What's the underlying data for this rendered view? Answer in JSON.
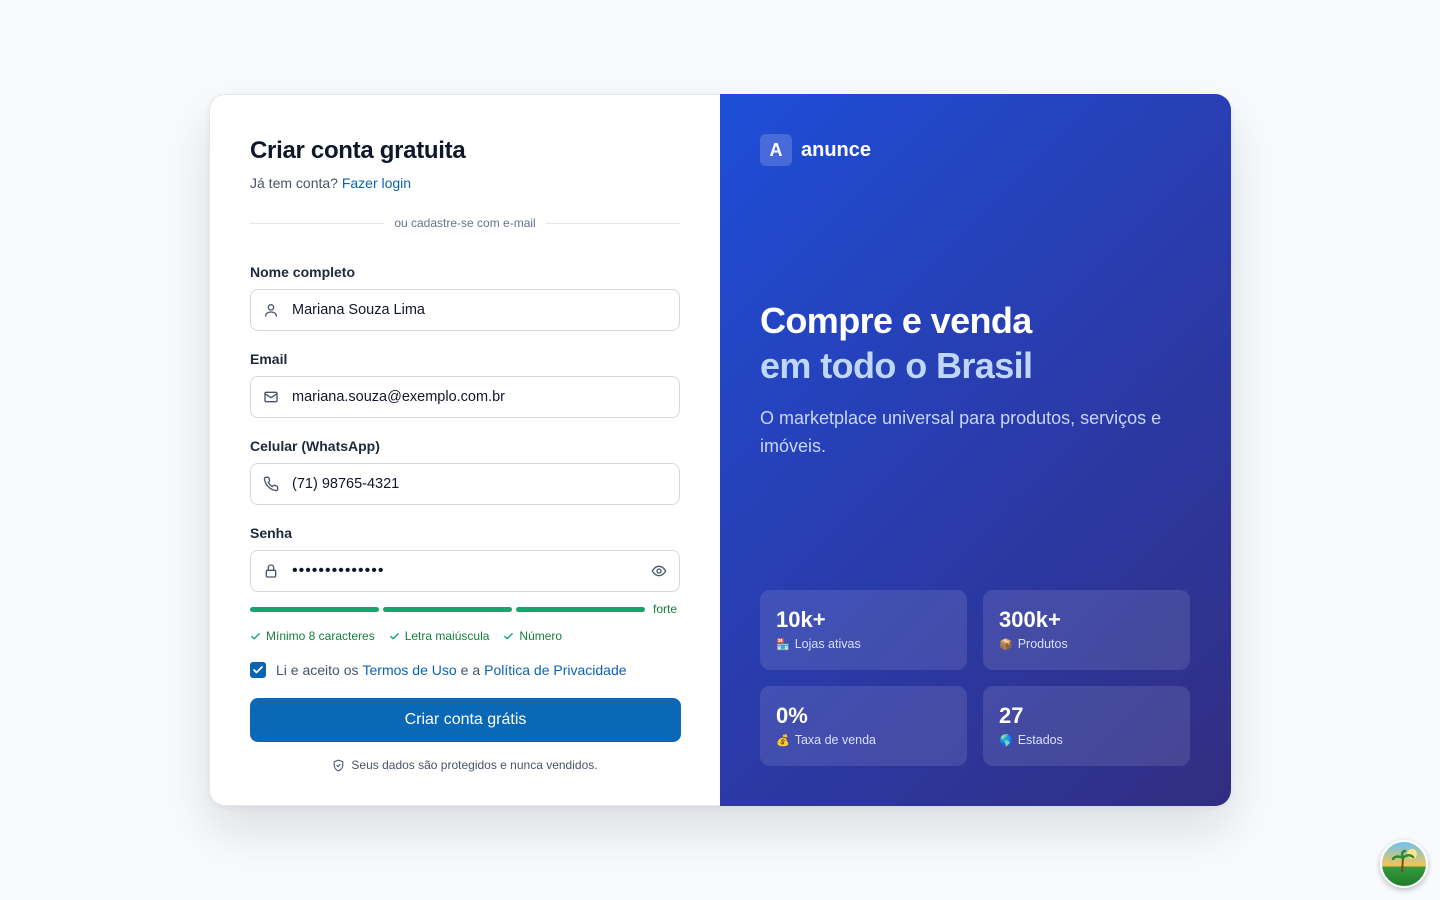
{
  "form": {
    "title": "Criar conta gratuita",
    "subtitle_text": "Já tem conta?",
    "login_link": "Fazer login",
    "divider_text": "ou cadastre-se com e-mail",
    "fields": {
      "name": {
        "label": "Nome completo",
        "value": "Mariana Souza Lima",
        "icon": "user-icon"
      },
      "email": {
        "label": "Email",
        "value": "mariana.souza@exemplo.com.br",
        "icon": "mail-icon"
      },
      "phone": {
        "label": "Celular (WhatsApp)",
        "value": "(71) 98765-4321",
        "icon": "phone-icon"
      },
      "password": {
        "label": "Senha",
        "value": "••••••••••••••",
        "icon": "lock-icon"
      }
    },
    "strength": {
      "label": "forte",
      "segments_filled": 3,
      "segments_total": 3,
      "color": "#16a56f"
    },
    "requirements": [
      "Mínimo 8 caracteres",
      "Letra maiúscula",
      "Número"
    ],
    "terms": {
      "checked": true,
      "prefix": "Li e aceito os",
      "terms_link": "Termos de Uso",
      "middle": "e a",
      "privacy_link": "Política de Privacidade"
    },
    "submit_label": "Criar conta grátis",
    "secure_note": "Seus dados são protegidos e nunca vendidos."
  },
  "brand": {
    "logo_letter": "A",
    "name": "anunce",
    "headline_line1": "Compre e venda",
    "headline_line2": "em todo o Brasil",
    "description": "O marketplace universal para produtos, serviços e imóveis."
  },
  "stats": [
    {
      "value": "10k+",
      "emoji": "🏪",
      "label": "Lojas ativas"
    },
    {
      "value": "300k+",
      "emoji": "📦",
      "label": "Produtos"
    },
    {
      "value": "0%",
      "emoji": "💰",
      "label": "Taxa de venda"
    },
    {
      "value": "27",
      "emoji": "🌎",
      "label": "Estados"
    }
  ],
  "colors": {
    "primary": "#0b68b6",
    "link": "#0b63b3",
    "success": "#16a56f",
    "panel_gradient_start": "#1d4ed8",
    "panel_gradient_end": "#312e81"
  }
}
